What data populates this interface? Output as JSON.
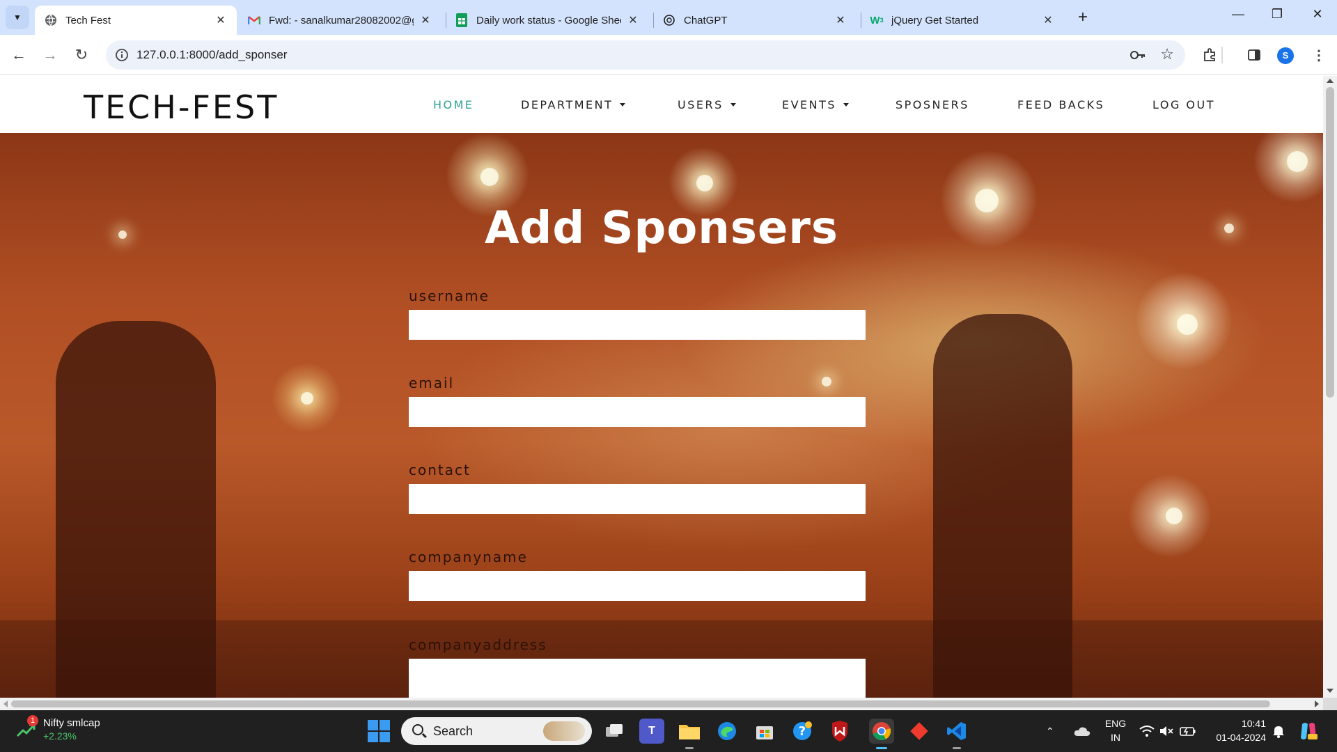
{
  "browser": {
    "tabs": [
      {
        "title": "Tech Fest",
        "icon": "globe-icon",
        "active": true
      },
      {
        "title": "Fwd: - sanalkumar28082002@g",
        "icon": "gmail-icon",
        "active": false
      },
      {
        "title": "Daily work status - Google Shee",
        "icon": "sheets-icon",
        "active": false
      },
      {
        "title": "ChatGPT",
        "icon": "chatgpt-icon",
        "active": false
      },
      {
        "title": "jQuery Get Started",
        "icon": "w3schools-icon",
        "active": false
      }
    ],
    "url": "127.0.0.1:8000/add_sponser",
    "profile_initial": "S"
  },
  "site": {
    "logo": "TECH-FEST",
    "nav": [
      {
        "label": "HOME",
        "active": true,
        "dropdown": false
      },
      {
        "label": "DEPARTMENT",
        "active": false,
        "dropdown": true
      },
      {
        "label": "USERS",
        "active": false,
        "dropdown": true
      },
      {
        "label": "EVENTS",
        "active": false,
        "dropdown": true
      },
      {
        "label": "SPOSNERS",
        "active": false,
        "dropdown": false
      },
      {
        "label": "FEED BACKS",
        "active": false,
        "dropdown": false
      },
      {
        "label": "LOG OUT",
        "active": false,
        "dropdown": false
      }
    ],
    "accent_color": "#2aa198"
  },
  "form": {
    "title": "Add Sponsers",
    "fields": [
      {
        "label": "username",
        "value": ""
      },
      {
        "label": "email",
        "value": ""
      },
      {
        "label": "contact",
        "value": ""
      },
      {
        "label": "companyname",
        "value": ""
      },
      {
        "label": "companyaddress",
        "value": ""
      }
    ]
  },
  "taskbar": {
    "stock_name": "Nifty smlcap",
    "stock_change": "+2.23%",
    "stock_badge": "1",
    "search_placeholder": "Search",
    "lang_line1": "ENG",
    "lang_line2": "IN",
    "time": "10:41",
    "date": "01-04-2024"
  }
}
